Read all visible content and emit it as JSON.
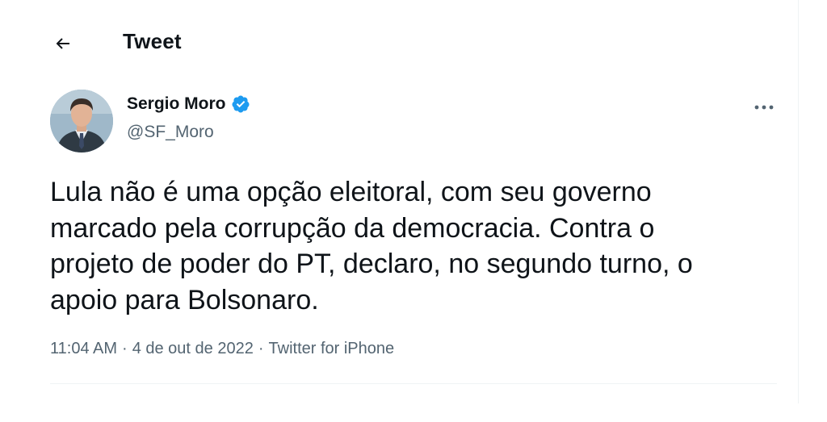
{
  "header": {
    "title": "Tweet",
    "back_icon": "arrow-left-icon"
  },
  "author": {
    "display_name": "Sergio Moro",
    "handle": "@SF_Moro",
    "verified_icon": "verified-badge-icon",
    "avatar_icon": "profile-photo-avatar"
  },
  "tweet": {
    "text": "Lula não é uma opção eleitoral, com seu governo\nmarcado pela corrupção da democracia. Contra o\nprojeto de poder do PT, declaro, no segundo turno, o\napoio para Bolsonaro.",
    "time": "11:04 AM",
    "date": "4 de out de 2022",
    "source": "Twitter for iPhone",
    "separator": "·",
    "more_icon": "more-options-icon"
  },
  "colors": {
    "text_primary": "#0f1419",
    "text_secondary": "#536471",
    "verified_blue": "#1d9bf0",
    "divider": "#eff3f4"
  }
}
